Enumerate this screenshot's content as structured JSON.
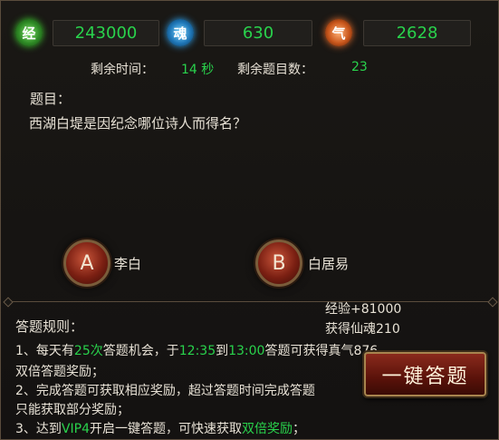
{
  "stats": {
    "exp": {
      "icon_glyph": "经",
      "icon": "exp-green-orb-icon",
      "value": "243000"
    },
    "soul": {
      "icon_glyph": "魂",
      "icon": "soul-blue-orb-icon",
      "value": "630"
    },
    "qi": {
      "icon_glyph": "气",
      "icon": "qi-red-orb-icon",
      "value": "2628"
    }
  },
  "timer": {
    "time_label": "剩余时间：",
    "time_value": "14 秒",
    "remaining_label": "剩余题目数：",
    "remaining_value": "23"
  },
  "question": {
    "title": "题目：",
    "text": "西湖白堤是因纪念哪位诗人而得名？"
  },
  "options": [
    {
      "letter": "A",
      "text": "李白"
    },
    {
      "letter": "B",
      "text": "白居易"
    }
  ],
  "rewards": {
    "exp": "经验+81000",
    "soul": "获得仙魂210"
  },
  "rules": {
    "title": "答题规则：",
    "r1_pre": "1、每天有",
    "r1_count": "25次",
    "r1_mid": "答题机会，于",
    "r1_start": "12:35",
    "r1_to": "到",
    "r1_end": "13:00",
    "r1_post": "答题可获得真气876",
    "r1_line2": "双倍答题奖励；",
    "r2_line1": "2、完成答题可获取相应奖励，超过答题时间完成答题",
    "r2_line2": "只能获取部分奖励；",
    "r3_pre": "3、达到",
    "r3_vip": "VIP4",
    "r3_mid": "开启一键答题，可快速获取",
    "r3_double": "双倍奖励",
    "r3_post": "；"
  },
  "onekey_label": "一键答题",
  "colors": {
    "accent_green": "#29d24c",
    "button_red": "#7a1f12",
    "border_gold": "#a8844e"
  }
}
